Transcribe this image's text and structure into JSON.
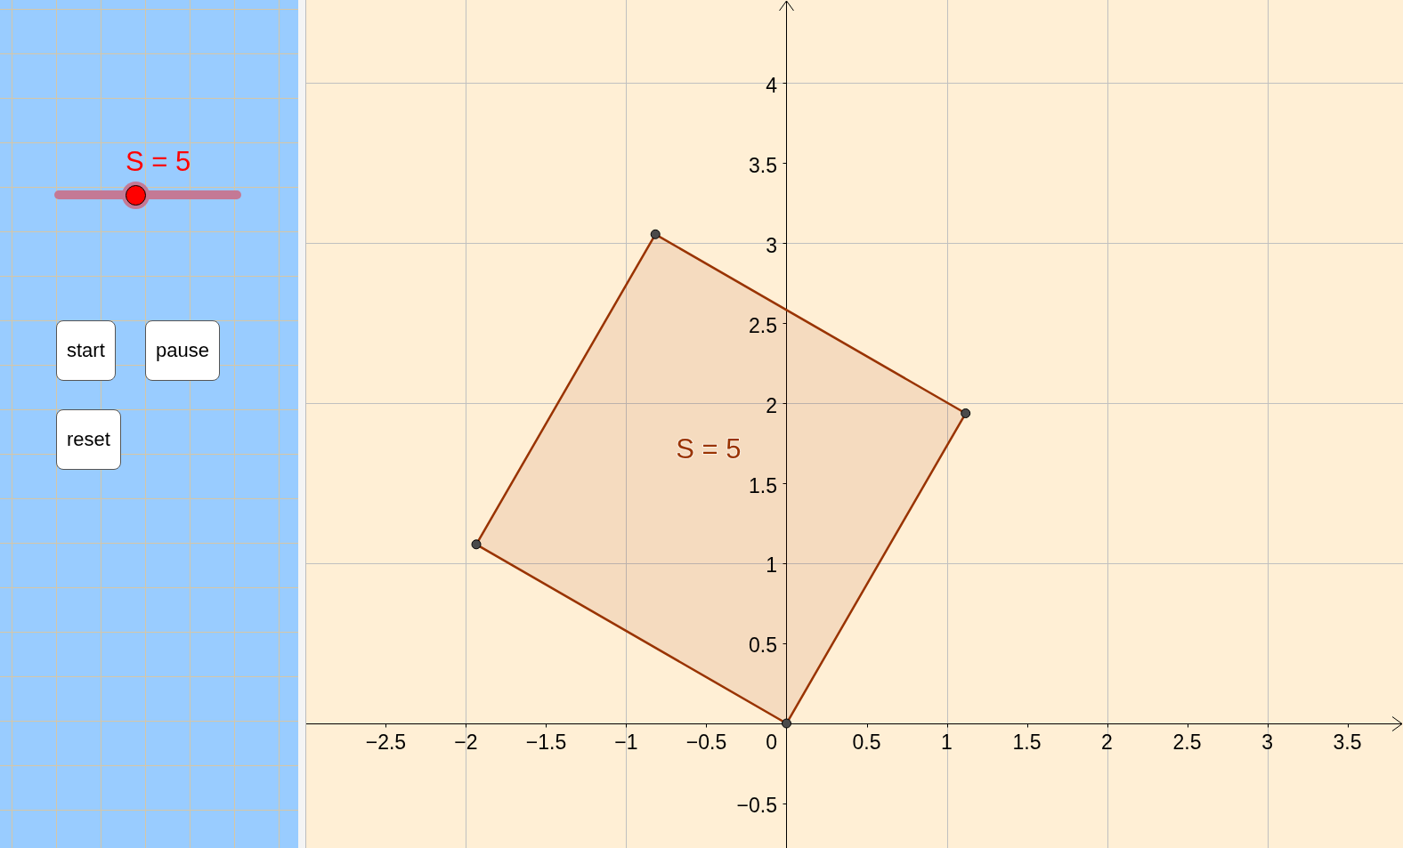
{
  "side_panel": {
    "slider": {
      "label": "S = 5",
      "level": 0.43
    },
    "buttons": [
      {
        "label": "start"
      },
      {
        "label": "pause"
      },
      {
        "label": "reset"
      }
    ]
  },
  "graphics_view": {
    "origin_label": "0",
    "chart_data": {
      "type": "area",
      "x": [
        0,
        1.118,
        -0.818,
        -1.936
      ],
      "series": [
        {
          "color": "#993300",
          "values": [
            0,
            1.936,
            3.054,
            1.118
          ]
        }
      ],
      "xlim": [
        -2.997,
        3.847
      ],
      "ylim": [
        -0.778,
        4.517
      ],
      "xticks": [
        {
          "value": -2.5,
          "label": "−2.5"
        },
        {
          "value": -2,
          "label": "−2"
        },
        {
          "value": -1.5,
          "label": "−1.5"
        },
        {
          "value": -1,
          "label": "−1"
        },
        {
          "value": -0.5,
          "label": "−0.5"
        },
        {
          "value": 0.5,
          "label": "0.5"
        },
        {
          "value": 1,
          "label": "1"
        },
        {
          "value": 1.5,
          "label": "1.5"
        },
        {
          "value": 2,
          "label": "2"
        },
        {
          "value": 2.5,
          "label": "2.5"
        },
        {
          "value": 3,
          "label": "3"
        },
        {
          "value": 3.5,
          "label": "3.5"
        }
      ],
      "yticks": [
        {
          "value": -0.5,
          "label": "−0.5"
        },
        {
          "value": 0.5,
          "label": "0.5"
        },
        {
          "value": 1,
          "label": "1"
        },
        {
          "value": 1.5,
          "label": "1.5"
        },
        {
          "value": 2,
          "label": "2"
        },
        {
          "value": 2.5,
          "label": "2.5"
        },
        {
          "value": 3,
          "label": "3"
        },
        {
          "value": 3.5,
          "label": "3.5"
        },
        {
          "value": 4,
          "label": "4"
        }
      ],
      "grid": true,
      "annotations": [
        "S = 5"
      ]
    }
  }
}
